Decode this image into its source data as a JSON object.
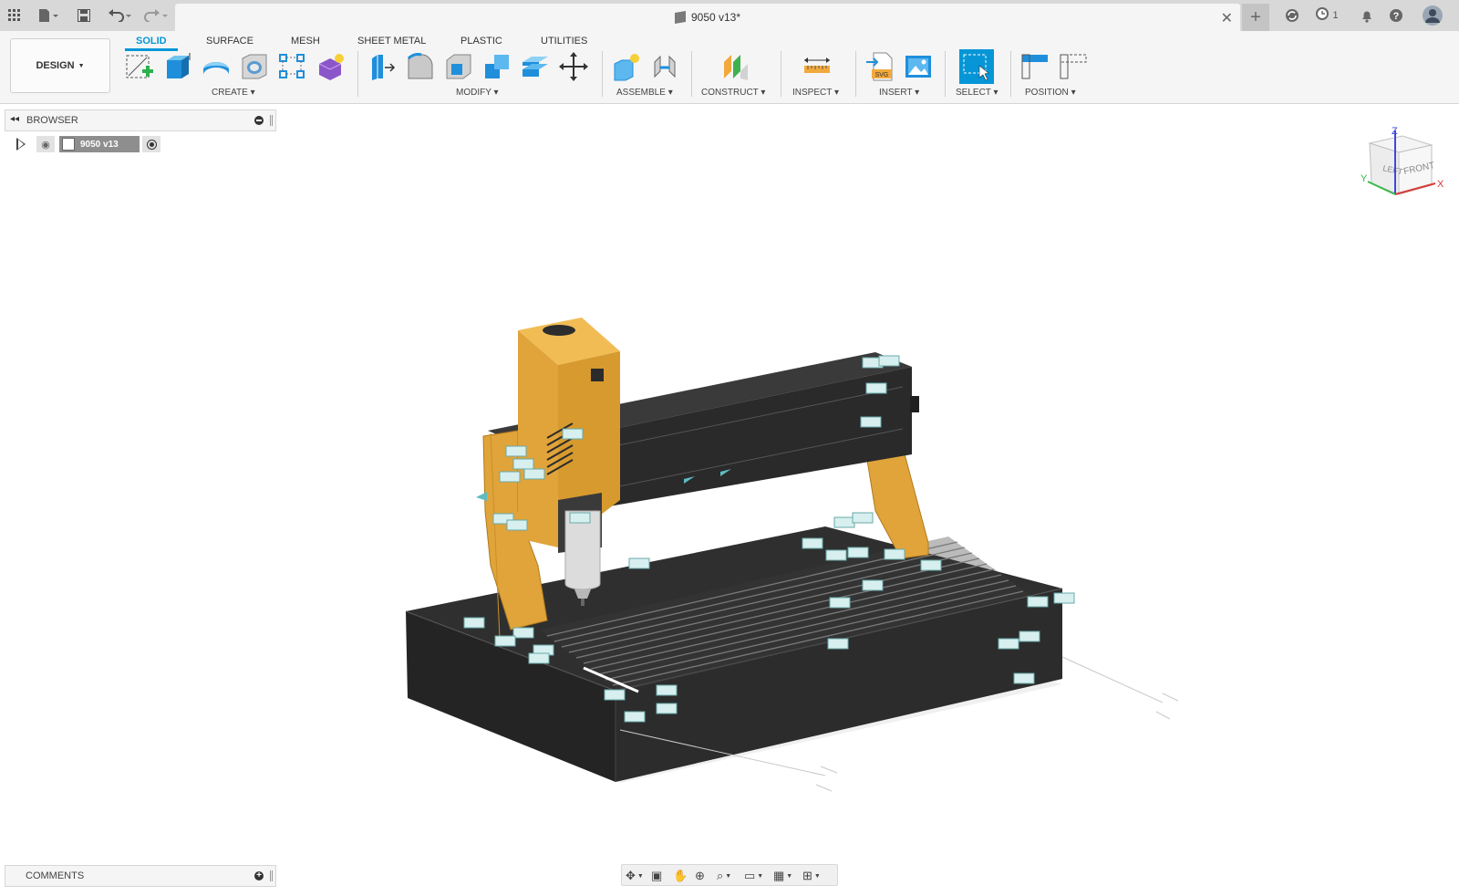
{
  "app": {
    "document_title": "9050 v13*",
    "notifications_count": "1",
    "icons": {
      "grid": "app-grid-icon",
      "file": "file-icon",
      "save": "save-icon",
      "undo": "undo-icon",
      "redo": "redo-icon",
      "close": "close-icon",
      "new_tab": "plus-icon",
      "refresh": "refresh-icon",
      "jobs": "clock-icon",
      "bell": "bell-icon",
      "help": "help-icon",
      "user": "user-avatar-icon"
    }
  },
  "toolbar": {
    "workspace": "DESIGN",
    "tabs": [
      "SOLID",
      "SURFACE",
      "MESH",
      "SHEET METAL",
      "PLASTIC",
      "UTILITIES"
    ],
    "active_tab": "SOLID",
    "groups": [
      "CREATE",
      "MODIFY",
      "ASSEMBLE",
      "CONSTRUCT",
      "INSPECT",
      "INSERT",
      "SELECT",
      "POSITION"
    ],
    "create_tools": [
      "create-sketch-icon",
      "extrude-icon",
      "revolve-icon",
      "hole-icon",
      "pattern-icon",
      "create-form-icon"
    ],
    "modify_tools": [
      "press-pull-icon",
      "fillet-icon",
      "shell-icon",
      "combine-icon",
      "offset-face-icon",
      "move-icon"
    ],
    "assemble_tools": [
      "new-component-icon",
      "joint-icon"
    ],
    "construct_tools": [
      "offset-plane-icon"
    ],
    "inspect_tools": [
      "measure-icon"
    ],
    "insert_tools": [
      "insert-svg-icon",
      "insert-canvas-icon"
    ],
    "select_tools": [
      "select-icon"
    ],
    "position_tools": [
      "capture-position-icon",
      "revert-position-icon"
    ],
    "colors": {
      "accent": "#0696d7"
    }
  },
  "browser": {
    "title": "BROWSER",
    "root_item": "9050 v13"
  },
  "viewcube": {
    "faces": [
      "LEFT",
      "FRONT"
    ],
    "axes": [
      "Z",
      "X",
      "Y"
    ]
  },
  "comments": {
    "title": "COMMENTS"
  },
  "navbar": {
    "tools": [
      "orbit-icon",
      "look-at-icon",
      "pan-icon",
      "zoom-icon",
      "fit-icon",
      "display-settings-icon",
      "grid-icon",
      "viewports-icon"
    ]
  },
  "model": {
    "colors": {
      "frame": "#e0a43a",
      "body": "#2b2b2b",
      "rails": "#4a4a4a",
      "spindle": "#d9d9d9"
    }
  }
}
